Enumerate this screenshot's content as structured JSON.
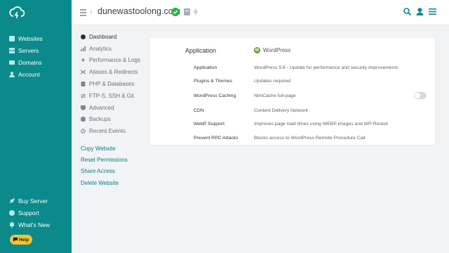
{
  "sidebar": {
    "nav": [
      {
        "label": "Websites",
        "icon": "websites-icon"
      },
      {
        "label": "Servers",
        "icon": "servers-icon"
      },
      {
        "label": "Domains",
        "icon": "domains-icon"
      },
      {
        "label": "Account",
        "icon": "account-icon"
      }
    ],
    "footer": [
      {
        "label": "Buy Server",
        "icon": "rocket-icon"
      },
      {
        "label": "Support",
        "icon": "support-icon"
      },
      {
        "label": "What's New",
        "icon": "bell-icon"
      }
    ],
    "help_label": "Help",
    "brand_color": "#0b8a8b"
  },
  "topbar": {
    "title": "dunewastoolong.com",
    "status": "verified",
    "status_color": "#2fb24f"
  },
  "submenu": {
    "items": [
      {
        "label": "Dashboard",
        "icon": "dashboard-icon",
        "active": true
      },
      {
        "label": "Analytics",
        "icon": "analytics-icon"
      },
      {
        "label": "Performance & Logs",
        "icon": "performance-icon"
      },
      {
        "label": "Aliases & Redirects",
        "icon": "redirects-icon"
      },
      {
        "label": "PHP & Databases",
        "icon": "php-icon"
      },
      {
        "label": "FTP-S, SSH & Git",
        "icon": "ftp-icon"
      },
      {
        "label": "Advanced",
        "icon": "advanced-icon"
      },
      {
        "label": "Backups",
        "icon": "backups-icon"
      },
      {
        "label": "Recent Events",
        "icon": "history-icon"
      }
    ],
    "actions": [
      {
        "label": "Copy Website"
      },
      {
        "label": "Reset Permissions"
      },
      {
        "label": "Share Access"
      },
      {
        "label": "Delete Website"
      }
    ]
  },
  "card": {
    "header_label": "Application",
    "header_value": "WordPress",
    "rows": [
      {
        "key": "Application",
        "value": "WordPress 5.6 - Update for performance and security improvements"
      },
      {
        "key": "Plugins & Themes",
        "value": "Updates required"
      },
      {
        "key": "WordPress Caching",
        "value": "NimCache full-page",
        "toggle": false
      },
      {
        "key": "CDN",
        "value": "Content Delivery Network"
      },
      {
        "key": "WebP Support",
        "value": "Improves page load times using WEBP images and WP-Rocket"
      },
      {
        "key": "Prevent RPC Attacks",
        "value": "Blocks access to WordPress Remote Procedure Call"
      }
    ]
  }
}
